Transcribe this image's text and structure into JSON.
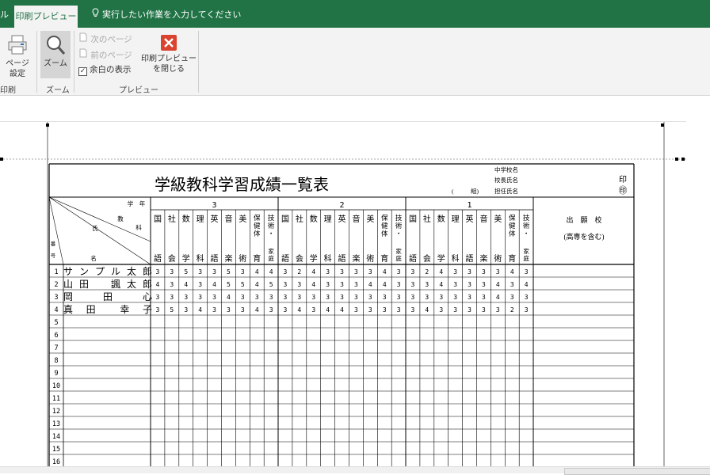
{
  "tabs": {
    "file_partial": "ル",
    "active": "印刷プレビュー",
    "tell_me": "実行したい作業を入力してください"
  },
  "ribbon": {
    "page_setup": "ページ\n設定",
    "group_print": "印刷",
    "zoom": "ズーム",
    "group_zoom": "ズーム",
    "next_page": "次のページ",
    "prev_page": "前のページ",
    "show_margins": "余白の表示",
    "close_preview": "印刷プレビュー\nを閉じる",
    "group_preview": "プレビュー"
  },
  "sheet": {
    "title": "学級教科学習成績一覧表",
    "school_label": "中学校名",
    "principal_label": "校長氏名",
    "teacher_label": "担任氏名",
    "paren_open": "(",
    "paren_class": "組)",
    "seal1": "印",
    "seal2": "㊞",
    "header_grade": "学　年",
    "header_subject_a": "教",
    "header_subject_b": "科",
    "header_name_a": "氏",
    "header_name_b": "名",
    "header_no_a": "番",
    "header_no_b": "号",
    "grades": [
      "3",
      "2",
      "1"
    ],
    "subjects": [
      {
        "top": "国",
        "bottom": "語"
      },
      {
        "top": "社",
        "bottom": "会"
      },
      {
        "top": "数",
        "bottom": "学"
      },
      {
        "top": "理",
        "bottom": "科"
      },
      {
        "top": "英",
        "bottom": "語"
      },
      {
        "top": "音",
        "bottom": "楽"
      },
      {
        "top": "美",
        "bottom": "術"
      },
      {
        "top": "保健体",
        "bottom": "育"
      },
      {
        "top": "技術・",
        "bottom": "家庭"
      }
    ],
    "apply_school": "出　願　校",
    "apply_note": "(高専を含む)",
    "rows": [
      {
        "no": "1",
        "name": "サンプル太郎",
        "scores": [
          "3",
          "3",
          "5",
          "3",
          "3",
          "5",
          "3",
          "4",
          "4",
          "3",
          "2",
          "4",
          "3",
          "3",
          "3",
          "3",
          "4",
          "3",
          "3",
          "2",
          "4",
          "3",
          "3",
          "3",
          "3",
          "4",
          "3"
        ]
      },
      {
        "no": "2",
        "name": "山田　諷太郎",
        "scores": [
          "4",
          "3",
          "4",
          "3",
          "4",
          "5",
          "5",
          "4",
          "5",
          "3",
          "3",
          "4",
          "3",
          "3",
          "3",
          "4",
          "4",
          "3",
          "3",
          "3",
          "4",
          "3",
          "3",
          "3",
          "4",
          "3",
          "4"
        ]
      },
      {
        "no": "3",
        "name": "岡　　田　　心",
        "scores": [
          "3",
          "3",
          "3",
          "3",
          "3",
          "4",
          "3",
          "3",
          "3",
          "3",
          "3",
          "3",
          "3",
          "3",
          "3",
          "3",
          "3",
          "3",
          "3",
          "3",
          "3",
          "3",
          "3",
          "3",
          "4",
          "3",
          "3"
        ]
      },
      {
        "no": "4",
        "name": "真　田　　幸　子",
        "scores": [
          "3",
          "5",
          "3",
          "4",
          "3",
          "3",
          "3",
          "4",
          "3",
          "3",
          "4",
          "3",
          "4",
          "4",
          "3",
          "3",
          "3",
          "3",
          "3",
          "4",
          "3",
          "3",
          "3",
          "3",
          "3",
          "2",
          "3"
        ]
      },
      {
        "no": "5",
        "name": "",
        "scores": []
      },
      {
        "no": "6",
        "name": "",
        "scores": []
      },
      {
        "no": "7",
        "name": "",
        "scores": []
      },
      {
        "no": "8",
        "name": "",
        "scores": []
      },
      {
        "no": "9",
        "name": "",
        "scores": []
      },
      {
        "no": "10",
        "name": "",
        "scores": []
      },
      {
        "no": "11",
        "name": "",
        "scores": []
      },
      {
        "no": "12",
        "name": "",
        "scores": []
      },
      {
        "no": "13",
        "name": "",
        "scores": []
      },
      {
        "no": "14",
        "name": "",
        "scores": []
      },
      {
        "no": "15",
        "name": "",
        "scores": []
      },
      {
        "no": "16",
        "name": "",
        "scores": []
      }
    ]
  }
}
